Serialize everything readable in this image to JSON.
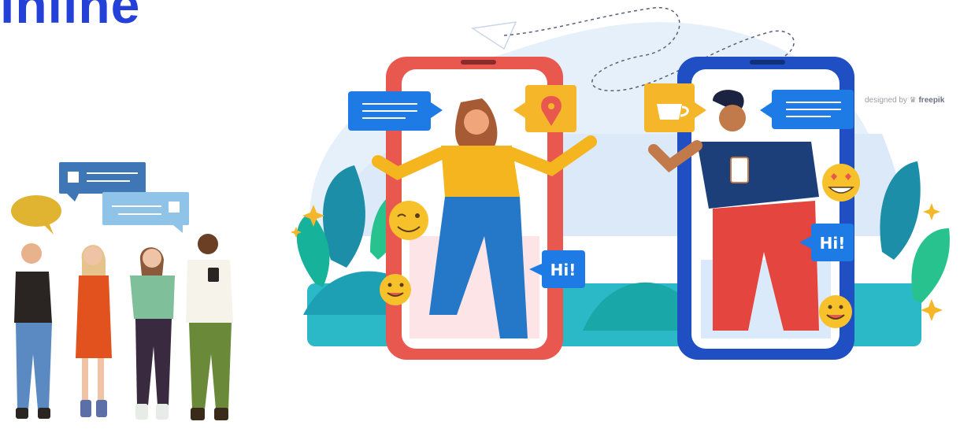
{
  "heading": "inline",
  "credit": {
    "prefix": "designed by",
    "brand": "freepik"
  },
  "bubbles": {
    "left_phone_hi": "Hi!",
    "right_phone_hi": "Hi!"
  },
  "colors": {
    "heading": "#2340d8",
    "left_phone": "#e8584f",
    "right_phone": "#1f4fc2",
    "chat_blue": "#1e7be6",
    "accent_yellow": "#f6b62a"
  }
}
